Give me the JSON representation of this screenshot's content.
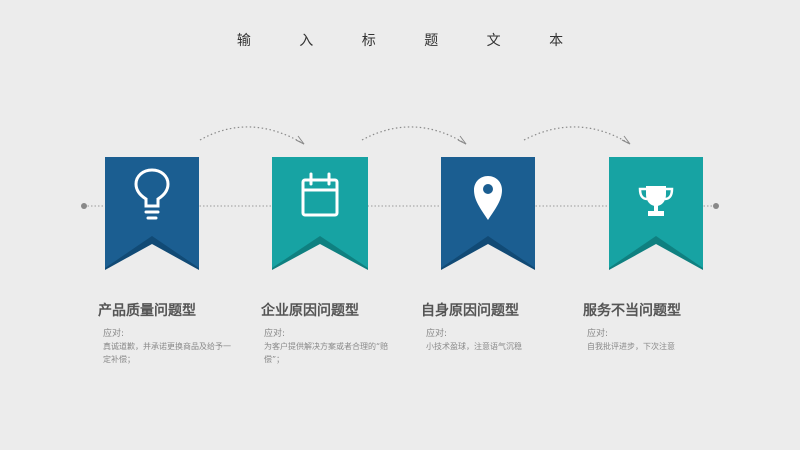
{
  "title": "输 入 标 题 文 本",
  "colors": {
    "blue": "#1b5e91",
    "teal": "#17a3a3",
    "blue_dark": "#114a75",
    "teal_dark": "#0f8080"
  },
  "cards": [
    {
      "icon": "lightbulb-icon",
      "color": "blue",
      "title": "产品质量问题型",
      "label": "应对:",
      "desc": "真诚道歉，并承诺更换商品及给予一定补偿；"
    },
    {
      "icon": "calendar-icon",
      "color": "teal",
      "title": "企业原因问题型",
      "label": "应对:",
      "desc": "为客户提供解决方案或者合理的“赔偿”；"
    },
    {
      "icon": "location-pin-icon",
      "color": "blue",
      "title": "自身原因问题型",
      "label": "应对:",
      "desc": "小技术盈球，注意语气沉稳"
    },
    {
      "icon": "trophy-icon",
      "color": "teal",
      "title": "服务不当问题型",
      "label": "应对:",
      "desc": "自我批评进步，下次注意"
    }
  ]
}
